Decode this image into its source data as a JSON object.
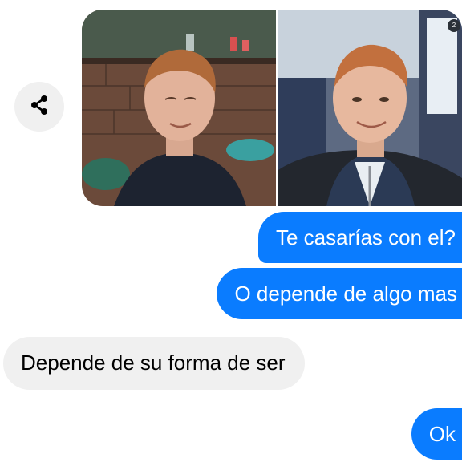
{
  "share": {
    "icon": "share-icon"
  },
  "photos": {
    "items": [
      {
        "name": "photo-selfie-workshop"
      },
      {
        "name": "photo-selfie-bus"
      }
    ],
    "count_badge": "2"
  },
  "messages": [
    {
      "direction": "outgoing",
      "text": "Te casarías con el?"
    },
    {
      "direction": "outgoing",
      "text": "O depende de algo mas"
    },
    {
      "direction": "incoming",
      "text": "Depende de su forma de ser"
    },
    {
      "direction": "outgoing",
      "text": "Ok"
    }
  ],
  "colors": {
    "outgoing_bubble": "#0a7cff",
    "incoming_bubble": "#f0f0f0",
    "background": "#ffffff"
  }
}
